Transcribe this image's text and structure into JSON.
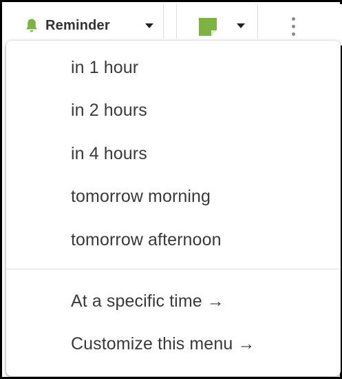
{
  "toolbar": {
    "reminder_label": "Reminder",
    "note_color": "#7cb342"
  },
  "menu": {
    "quick_options": [
      {
        "label": "in 1 hour"
      },
      {
        "label": "in 2 hours"
      },
      {
        "label": "in 4 hours"
      },
      {
        "label": "tomorrow morning"
      },
      {
        "label": "tomorrow afternoon"
      }
    ],
    "more_options": [
      {
        "label": "At a specific time →"
      },
      {
        "label": "Customize this menu →"
      }
    ]
  },
  "colors": {
    "bell_green": "#7cb342",
    "text": "#3a3a3a",
    "divider": "#e1e1e1"
  }
}
